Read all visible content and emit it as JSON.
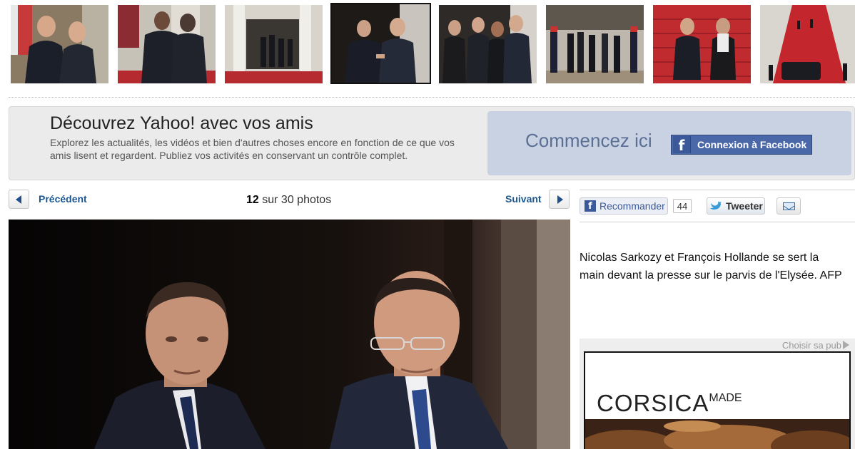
{
  "thumbnails": [
    {
      "name": "thumb-1"
    },
    {
      "name": "thumb-2"
    },
    {
      "name": "thumb-3"
    },
    {
      "name": "thumb-4",
      "selected": true
    },
    {
      "name": "thumb-5"
    },
    {
      "name": "thumb-6"
    },
    {
      "name": "thumb-7"
    },
    {
      "name": "thumb-8"
    }
  ],
  "promo": {
    "title": "Découvrez Yahoo! avec vos amis",
    "text": "Explorez les actualités, les vidéos et bien d'autres choses encore en fonction de ce que vos amis lisent et regardent. Publiez vos activités en conservant un contrôle complet.",
    "start_label": "Commencez ici",
    "fb_button_label": "Connexion à Facebook",
    "fb_icon_glyph": "f"
  },
  "nav": {
    "prev_label": "Précédent",
    "next_label": "Suivant",
    "current": "12",
    "counter_suffix": "sur 30 photos"
  },
  "social": {
    "recommend_label": "Recommander",
    "recommend_count": "44",
    "tweet_label": "Tweeter",
    "fb_glyph": "f"
  },
  "caption": "Nicolas Sarkozy et François Hollande se sert la main devant la presse sur le parvis de l'Elysée. AFP",
  "ad": {
    "label": "Choisir sa pub",
    "brand": "CORSICA",
    "brand_sup": "MADE"
  },
  "colors": {
    "link_blue": "#1c5691",
    "facebook_blue": "#3b5998",
    "promo_bg": "#ebebeb",
    "promo_right_bg": "#c9d2e3"
  },
  "icons": [
    "prev-arrow-icon",
    "next-arrow-icon",
    "facebook-icon",
    "twitter-bird-icon",
    "mail-icon",
    "play-icon"
  ]
}
